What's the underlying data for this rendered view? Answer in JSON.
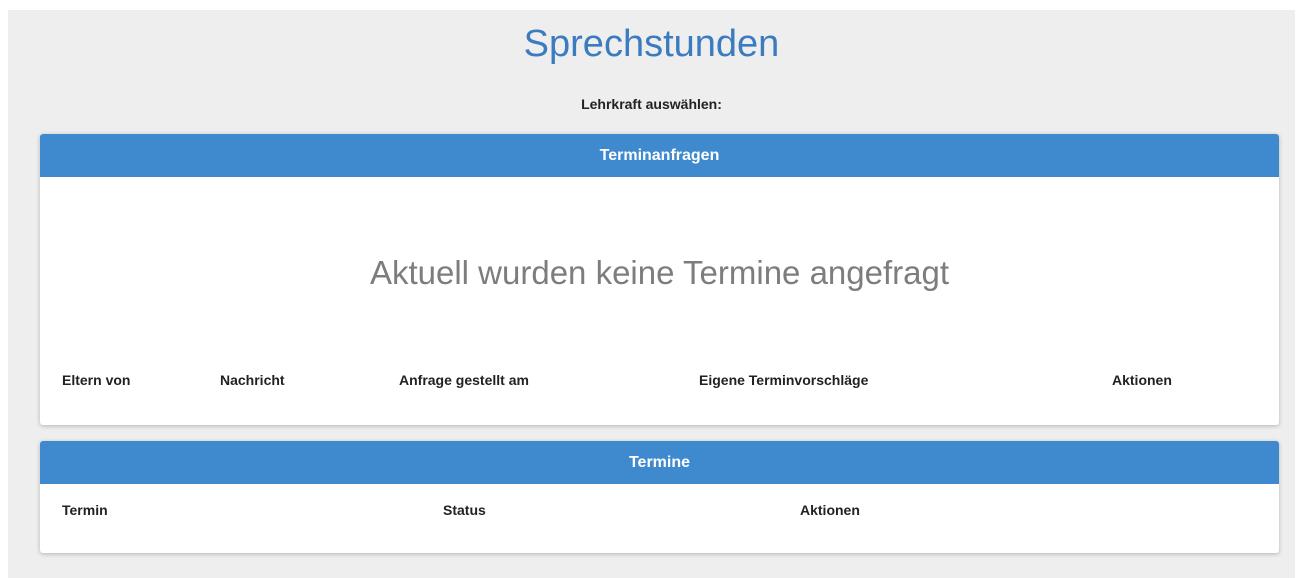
{
  "page": {
    "title": "Sprechstunden",
    "teacher_select_label": "Lehrkraft auswählen:"
  },
  "requests_card": {
    "header": "Terminanfragen",
    "empty_message": "Aktuell wurden keine Termine angefragt",
    "columns": [
      "Eltern von",
      "Nachricht",
      "Anfrage gestellt am",
      "Eigene Terminvorschläge",
      "Aktionen"
    ]
  },
  "appointments_card": {
    "header": "Termine",
    "columns": [
      "Termin",
      "Status",
      "Aktionen"
    ]
  },
  "colors": {
    "accent": "#3f8ace",
    "title": "#3b7bbf",
    "background": "#eeeeee"
  }
}
